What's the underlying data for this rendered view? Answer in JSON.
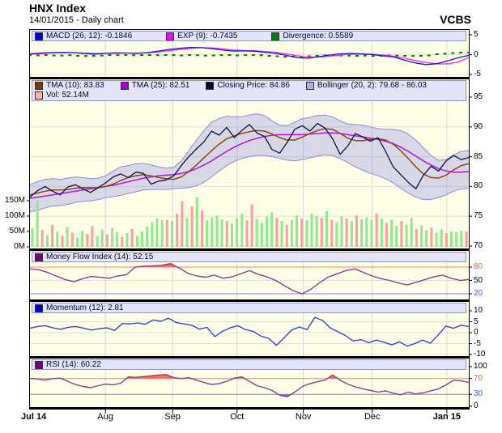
{
  "header": {
    "title": "HNX Index",
    "subtitle": "14/01/2015 - Daily chart",
    "brand": "VCBS"
  },
  "colors": {
    "panel_bg": "#FFFFE8",
    "legend_bg": "#E4E4F8",
    "legend_border": "#9494C4",
    "frame": "#000000",
    "grid_v": "#D4D4DE",
    "grid_h": "#E0E0D8",
    "overbought_label": "#FF5540",
    "oversold_label": "#4455FF",
    "overbought_line": "#FF8070",
    "oversold_line": "#8080FF",
    "volume_green": "#8FE88F",
    "volume_red": "#FF9C9C"
  },
  "x_axis": {
    "grid_fracs": [
      0.172,
      0.325,
      0.472,
      0.623,
      0.78,
      0.95
    ],
    "labels": [
      {
        "text": "Jul 14",
        "frac": 0.0,
        "bold": true,
        "align": "left"
      },
      {
        "text": "Aug",
        "frac": 0.172,
        "bold": false
      },
      {
        "text": "Sep",
        "frac": 0.325,
        "bold": false
      },
      {
        "text": "Oct",
        "frac": 0.472,
        "bold": false
      },
      {
        "text": "Nov",
        "frac": 0.623,
        "bold": false
      },
      {
        "text": "Dec",
        "frac": 0.78,
        "bold": false
      },
      {
        "text": "Jan 15",
        "frac": 0.95,
        "bold": true
      }
    ]
  },
  "chart_data": [
    {
      "id": "macd",
      "type": "line",
      "title": "MACD panel",
      "ylim": [
        -5.5,
        6.5
      ],
      "yticks": [
        {
          "v": 5,
          "label": "5"
        },
        {
          "v": 0,
          "label": "0"
        },
        {
          "v": -5,
          "label": "-5"
        }
      ],
      "legend": [
        {
          "swatch": "#0000DD",
          "text": "MACD (26, 12): -0.1846"
        },
        {
          "swatch": "#FF00FF",
          "text": "EXP (9): -0.7435"
        },
        {
          "swatch": "#008000",
          "text": "Divergence: 0.5589"
        }
      ],
      "series": [
        {
          "name": "Divergence",
          "color": "#008000",
          "style": "dots",
          "values": [
            -0.15,
            -0.2,
            -0.1,
            -0.2,
            -0.25,
            -0.15,
            -0.3,
            -0.35,
            -0.3,
            -0.25,
            -0.1,
            -0.15,
            -0.1,
            -0.15,
            -0.1,
            -0.1,
            -0.15,
            -0.1,
            -0.15,
            -0.2,
            -0.1,
            -0.15,
            -0.25,
            -0.2,
            -0.15,
            -0.1,
            -0.2,
            -0.15,
            -0.1,
            -0.15,
            -0.3,
            -0.4,
            -0.5,
            -0.45,
            -0.55,
            -0.4,
            -0.3,
            -0.2,
            -0.15,
            -0.2,
            -0.25,
            -0.3,
            -0.25,
            -0.35,
            -0.3,
            -0.2,
            -0.25,
            -0.3,
            -0.35,
            -0.3,
            -0.2,
            0.1,
            0.25,
            0.4,
            0.5,
            0.5589
          ]
        },
        {
          "name": "EXP (9)",
          "color": "#FF22FF",
          "width": 1.3,
          "values": [
            0.1,
            0.25,
            0.4,
            0.5,
            0.5,
            0.4,
            0.3,
            0.3,
            0.35,
            0.4,
            0.4,
            0.45,
            0.7,
            1.0,
            1.3,
            1.6,
            1.75,
            1.7,
            1.45,
            1.15,
            1.05,
            1.0,
            0.8,
            0.55,
            0.2,
            -0.3,
            -0.6,
            -0.6,
            -0.4,
            -0.1,
            0.1,
            0.15,
            0.1,
            -0.1,
            -0.4,
            -0.9,
            -1.5,
            -2.0,
            -2.3,
            -2.35,
            -1.9,
            -0.74
          ]
        },
        {
          "name": "MACD (26, 12)",
          "color": "#1414E6",
          "width": 1.3,
          "values": [
            0.2,
            0.4,
            0.5,
            0.55,
            0.5,
            0.3,
            0.15,
            0.3,
            0.45,
            0.4,
            0.3,
            0.5,
            0.9,
            1.3,
            1.6,
            1.8,
            1.75,
            1.5,
            1.15,
            0.9,
            0.95,
            0.85,
            0.6,
            0.3,
            -0.2,
            -0.8,
            -0.9,
            -0.5,
            -0.1,
            0.2,
            0.3,
            0.2,
            0.0,
            -0.3,
            -0.6,
            -1.4,
            -2.1,
            -2.5,
            -2.3,
            -1.6,
            -0.8,
            -0.18
          ]
        }
      ]
    },
    {
      "id": "main",
      "type": "line",
      "title": "Price panel",
      "ylim": [
        69.5,
        96.5
      ],
      "yticks": [
        {
          "v": 95,
          "label": "95"
        },
        {
          "v": 90,
          "label": "90"
        },
        {
          "v": 85,
          "label": "85"
        },
        {
          "v": 80,
          "label": "80"
        },
        {
          "v": 75,
          "label": "75"
        },
        {
          "v": 70,
          "label": "70"
        }
      ],
      "legend": [
        {
          "swatch": "#7B3A00",
          "text": "TMA (10): 83.83"
        },
        {
          "swatch": "#A000E0",
          "text": "TMA (25): 82.51"
        },
        {
          "swatch": "#000033",
          "text": "Closing Price: 84.86"
        },
        {
          "swatch": "#AAB4EC",
          "text": "Bollinger (20, 2): 79.68 - 86.03"
        }
      ],
      "legend2": [
        {
          "swatch": "#FFAFA8",
          "text": "Vol: 52.14M"
        }
      ],
      "band": {
        "name": "Bollinger (20, 2)",
        "color": "#8C8CD8",
        "fill": "rgba(150,150,225,0.38)",
        "upper": [
          80.3,
          80.8,
          81.2,
          81.3,
          81.2,
          81.4,
          81.6,
          81.5,
          81.3,
          81.4,
          81.8,
          82.6,
          83.3,
          83.5,
          83.8,
          83.9,
          83.6,
          83.3,
          83.1,
          83.2,
          84.3,
          86.0,
          87.8,
          89.4,
          90.8,
          91.4,
          91.8,
          91.7,
          91.7,
          92.0,
          92.2,
          91.9,
          91.0,
          90.3,
          90.2,
          90.8,
          91.4,
          91.6,
          91.9,
          92.0,
          91.7,
          91.0,
          90.5,
          90.4,
          90.3,
          90.0,
          89.7,
          89.6,
          89.6,
          89.4,
          88.8,
          87.8,
          86.5,
          85.2,
          84.4,
          84.5,
          85.3,
          85.9,
          86.03
        ],
        "lower": [
          75.7,
          76.0,
          76.4,
          76.7,
          76.8,
          77.0,
          77.3,
          77.5,
          77.6,
          77.8,
          78.1,
          78.3,
          78.5,
          78.8,
          79.1,
          79.4,
          79.5,
          79.5,
          79.5,
          79.6,
          79.7,
          79.8,
          80.1,
          80.7,
          81.6,
          82.6,
          83.5,
          84.2,
          84.7,
          85.0,
          85.2,
          85.2,
          85.0,
          84.7,
          84.4,
          84.3,
          84.5,
          84.8,
          85.1,
          85.3,
          85.2,
          84.7,
          84.0,
          83.3,
          82.7,
          82.2,
          81.8,
          81.3,
          80.6,
          79.7,
          78.9,
          78.2,
          77.8,
          77.8,
          78.1,
          78.6,
          79.2,
          79.6,
          79.68
        ]
      },
      "volume": {
        "name": "Vol",
        "green": "#8FE88F",
        "red": "#FF9C9C",
        "yticks": [
          {
            "v": 150,
            "label": "150M"
          },
          {
            "v": 100,
            "label": "100M"
          },
          {
            "v": 50,
            "label": "50M"
          },
          {
            "v": 0,
            "label": "0M"
          }
        ],
        "values": [
          60,
          150,
          55,
          38,
          72,
          50,
          36,
          64,
          46,
          30,
          52,
          42,
          68,
          35,
          56,
          40,
          62,
          48,
          33,
          45,
          58,
          36,
          50,
          66,
          80,
          92,
          86,
          88,
          84,
          108,
          148,
          94,
          132,
          162,
          118,
          86,
          96,
          102,
          90,
          84,
          76,
          94,
          108,
          86,
          138,
          90,
          78,
          98,
          112,
          94,
          84,
          72,
          88,
          102,
          92,
          86,
          108,
          100,
          94,
          116,
          88,
          80,
          98,
          92,
          84,
          102,
          90,
          96,
          86,
          108,
          92,
          78,
          88,
          68,
          84,
          72,
          94,
          58,
          70,
          54,
          62,
          46,
          56,
          44,
          50,
          48,
          52,
          50
        ],
        "colors": "ggrgrgrgrggrrggrggrgrggggggrgrrgrgrggggrgggrrggggrgrggrgggrgrggrgrgggrgrggrggrggrggrgggr"
      },
      "series": [
        {
          "name": "TMA (25)",
          "color": "#B414DC",
          "width": 1.5,
          "values": [
            78.0,
            78.2,
            78.4,
            78.6,
            78.8,
            79.0,
            79.2,
            79.4,
            79.6,
            79.8,
            80.0,
            80.2,
            80.5,
            80.8,
            81.1,
            81.4,
            81.6,
            81.8,
            81.9,
            82.0,
            82.2,
            82.5,
            83.0,
            83.6,
            84.3,
            85.1,
            85.9,
            86.6,
            87.2,
            87.7,
            88.1,
            88.4,
            88.6,
            88.7,
            88.7,
            88.7,
            88.7,
            88.8,
            88.9,
            89.0,
            89.0,
            88.9,
            88.7,
            88.5,
            88.3,
            88.1,
            87.9,
            87.6,
            87.2,
            86.6,
            85.9,
            85.1,
            84.3,
            83.6,
            83.0,
            82.6,
            82.4,
            82.4,
            82.51
          ]
        },
        {
          "name": "TMA (10)",
          "color": "#8A4A14",
          "width": 1.5,
          "values": [
            78.6,
            78.9,
            79.2,
            79.4,
            79.4,
            79.5,
            79.7,
            79.8,
            79.8,
            79.8,
            80.0,
            80.4,
            81.0,
            81.5,
            81.8,
            82.0,
            81.8,
            81.5,
            81.3,
            81.2,
            81.6,
            82.5,
            83.6,
            84.8,
            86.0,
            87.1,
            88.0,
            88.5,
            88.9,
            89.2,
            89.4,
            89.3,
            88.8,
            88.2,
            87.8,
            87.8,
            88.3,
            88.9,
            89.4,
            89.7,
            89.6,
            88.9,
            88.1,
            87.7,
            87.7,
            87.9,
            88.0,
            87.8,
            87.1,
            86.0,
            84.7,
            83.3,
            82.1,
            81.5,
            81.4,
            81.9,
            82.8,
            83.5,
            83.83
          ]
        },
        {
          "name": "Closing Price",
          "color": "#10104A",
          "width": 1.3,
          "values": [
            78.2,
            79.3,
            80.0,
            79.2,
            78.6,
            79.9,
            80.3,
            79.6,
            79.0,
            79.8,
            80.6,
            81.6,
            82.1,
            81.5,
            82.4,
            82.2,
            80.4,
            80.9,
            81.1,
            81.8,
            83.5,
            85.0,
            86.3,
            87.5,
            89.3,
            88.6,
            89.9,
            88.2,
            89.4,
            90.4,
            89.0,
            88.4,
            86.2,
            85.6,
            87.4,
            89.6,
            90.2,
            89.3,
            90.6,
            89.8,
            88.0,
            85.4,
            86.8,
            88.9,
            88.3,
            87.6,
            88.2,
            85.9,
            83.3,
            82.0,
            80.7,
            79.6,
            81.9,
            83.4,
            82.6,
            84.3,
            85.2,
            84.5,
            84.86
          ]
        }
      ]
    },
    {
      "id": "mfi",
      "type": "line",
      "title": "Money Flow Index panel",
      "ylim": [
        15,
        95
      ],
      "yticks": [
        {
          "v": 80,
          "label": "80",
          "color": "#FF5540",
          "line": "#FF8070"
        },
        {
          "v": 50,
          "label": "50"
        },
        {
          "v": 20,
          "label": "20",
          "color": "#4455FF",
          "line": "#8080FF"
        }
      ],
      "legend": [
        {
          "swatch": "#7A007A",
          "text": "Money Flow Index (14): 52.15"
        }
      ],
      "fills": [
        {
          "series": 0,
          "threshold": 80,
          "mode": "over",
          "color": "#FF6A55"
        }
      ],
      "series": [
        {
          "name": "Money Flow Index (14)",
          "color": "#8F3C8F",
          "width": 1.4,
          "values": [
            76,
            74,
            68,
            60,
            52,
            47,
            54,
            59,
            57,
            55,
            60,
            63,
            80,
            82,
            83,
            84,
            88,
            78,
            66,
            60,
            57,
            62,
            55,
            58,
            65,
            72,
            64,
            58,
            50,
            38,
            27,
            20,
            30,
            45,
            58,
            65,
            72,
            76,
            68,
            60,
            54,
            50,
            44,
            40,
            46,
            52,
            58,
            62,
            55,
            50,
            52.15
          ]
        }
      ]
    },
    {
      "id": "momentum",
      "type": "line",
      "title": "Momentum panel",
      "ylim": [
        -11,
        11
      ],
      "yticks": [
        {
          "v": 10,
          "label": "10"
        },
        {
          "v": 5,
          "label": "5"
        },
        {
          "v": 0,
          "label": "0"
        },
        {
          "v": -5,
          "label": "-5"
        },
        {
          "v": -10,
          "label": "-10"
        }
      ],
      "legend": [
        {
          "swatch": "#0000CC",
          "text": "Momentum (12): 2.81"
        }
      ],
      "series": [
        {
          "name": "Momentum (12)",
          "color": "#3344E0",
          "width": 1.4,
          "values": [
            2.0,
            2.8,
            3.2,
            2.2,
            1.5,
            2.5,
            2.8,
            2.0,
            1.2,
            1.8,
            2.2,
            1.0,
            4.2,
            4.0,
            4.4,
            3.8,
            5.8,
            5.2,
            6.6,
            4.6,
            4.0,
            3.4,
            1.6,
            2.4,
            -1.8,
            0.6,
            2.2,
            3.2,
            1.4,
            0.6,
            -1.6,
            -2.6,
            -5.8,
            -2.4,
            1.2,
            2.6,
            1.4,
            7.0,
            5.6,
            2.2,
            0.4,
            -1.4,
            -3.8,
            -3.2,
            -4.6,
            -3.4,
            -4.4,
            -5.6,
            -4.2,
            -6.2,
            -5.0,
            -3.4,
            -4.8,
            -1.2,
            3.0,
            2.0,
            3.4,
            2.81
          ]
        }
      ]
    },
    {
      "id": "rsi",
      "type": "line",
      "title": "RSI panel",
      "ylim": [
        0,
        102
      ],
      "yticks": [
        {
          "v": 100,
          "label": "100"
        },
        {
          "v": 70,
          "label": "70",
          "color": "#FF5540",
          "line": "#FF8070"
        },
        {
          "v": 30,
          "label": "30",
          "color": "#4455FF",
          "line": "#8080FF"
        },
        {
          "v": 0,
          "label": "0"
        }
      ],
      "legend": [
        {
          "swatch": "#7A007A",
          "text": "RSI (14): 60.22"
        }
      ],
      "fills": [
        {
          "series": 0,
          "threshold": 70,
          "mode": "over",
          "color": "#FF6A55"
        },
        {
          "series": 0,
          "threshold": 30,
          "mode": "under",
          "color": "#6A6AFF"
        }
      ],
      "series": [
        {
          "name": "RSI (14)",
          "color": "#8F3C8F",
          "width": 1.4,
          "values": [
            70,
            69,
            66,
            70,
            71,
            63,
            55,
            50,
            47,
            52,
            56,
            54,
            58,
            74,
            73,
            75,
            77,
            79,
            80,
            72,
            70,
            72,
            66,
            60,
            55,
            57,
            63,
            71,
            74,
            63,
            52,
            47,
            40,
            28,
            24,
            36,
            50,
            57,
            62,
            66,
            79,
            66,
            56,
            49,
            44,
            40,
            36,
            39,
            33,
            29,
            36,
            31,
            34,
            39,
            44,
            54,
            66,
            64,
            60.22
          ]
        }
      ]
    }
  ]
}
